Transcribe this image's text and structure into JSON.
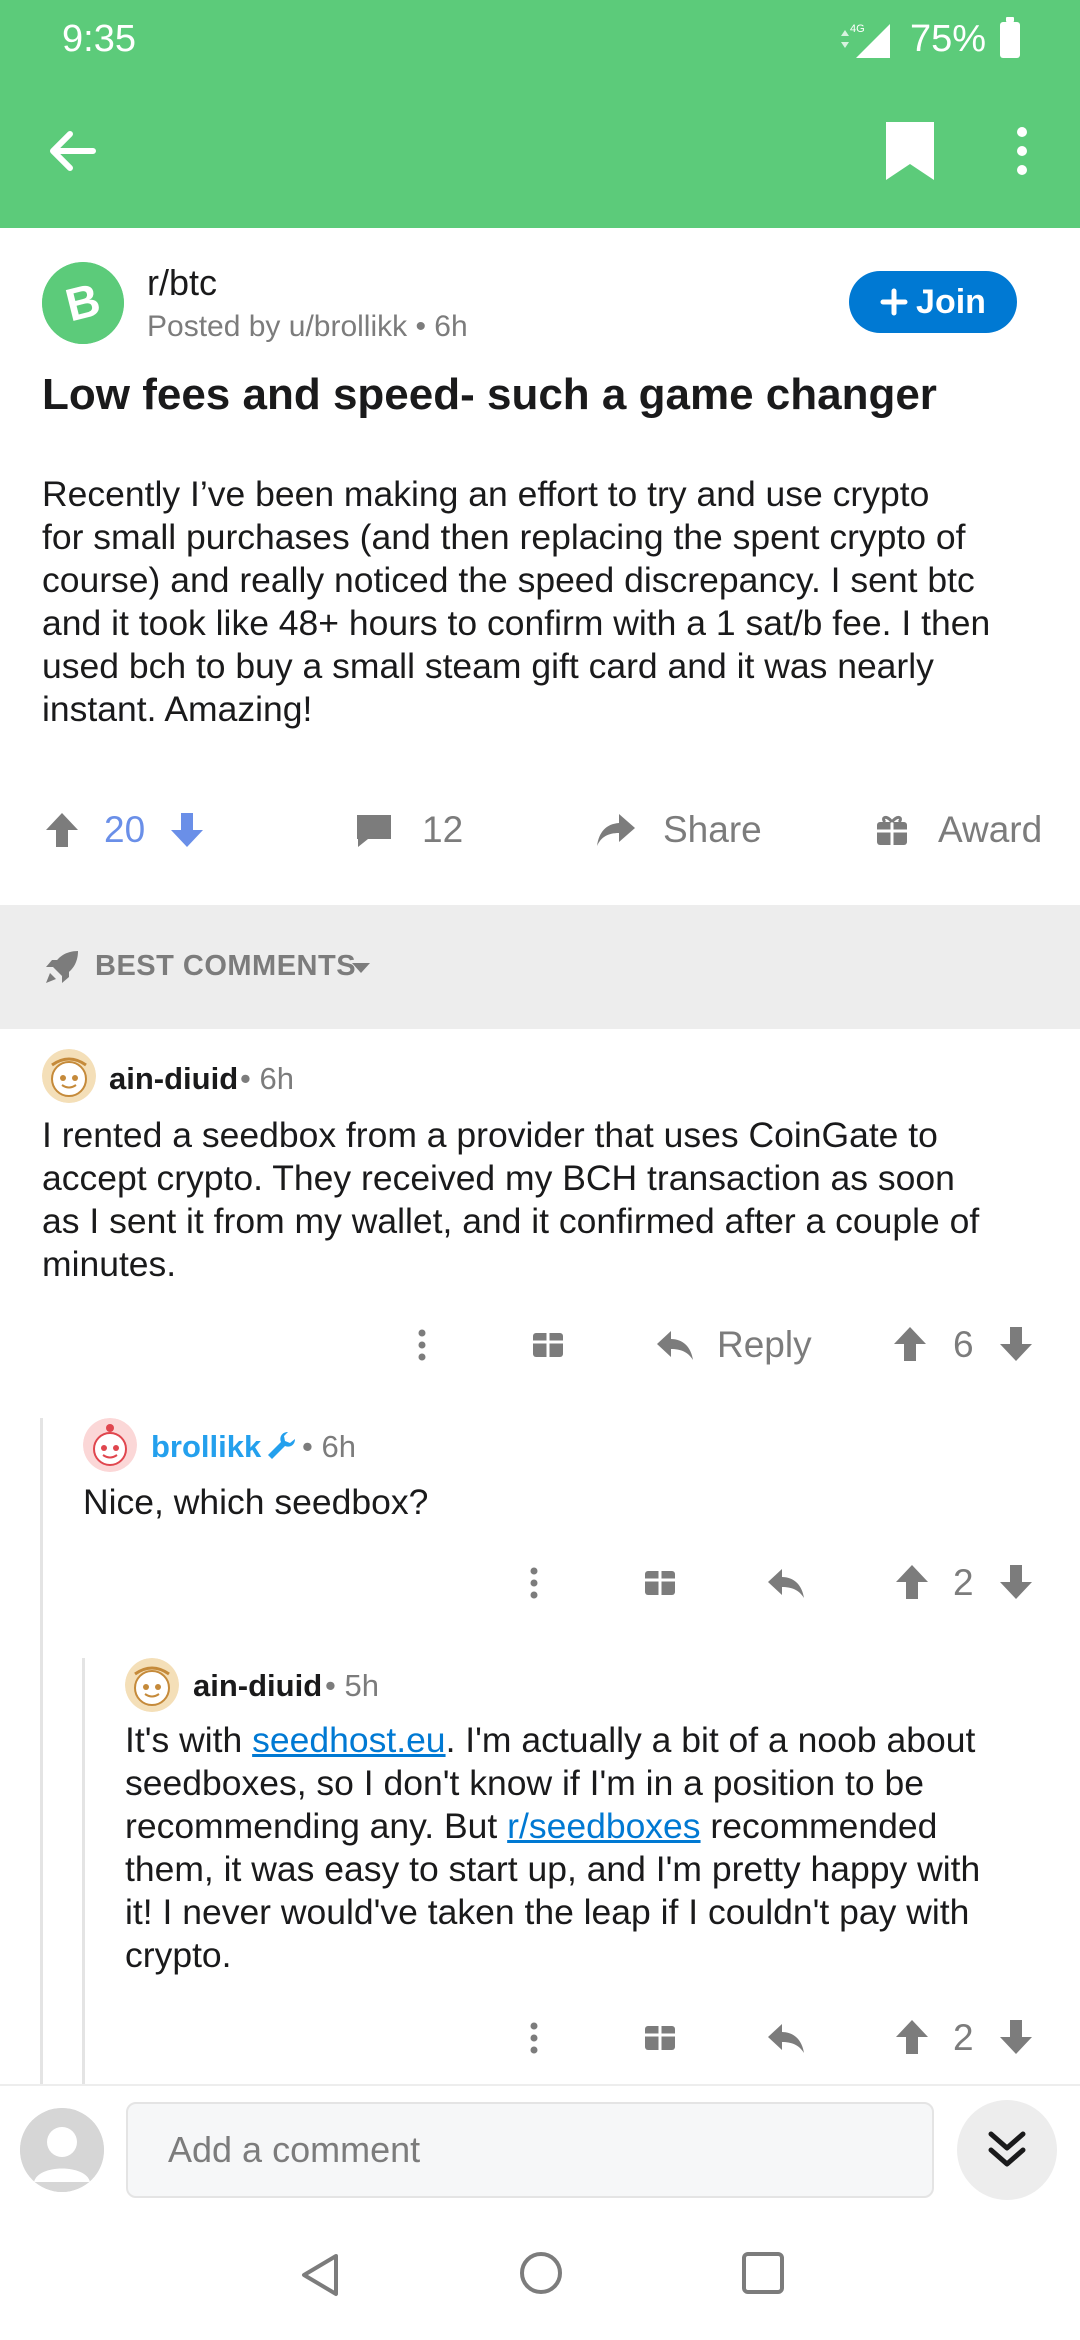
{
  "status_bar": {
    "time": "9:35",
    "network": "4G",
    "battery": "75%"
  },
  "app_bar": {
    "back_icon": "arrow-left-icon",
    "bookmark_icon": "bookmark-icon",
    "more_icon": "more-vert-icon"
  },
  "post": {
    "subreddit": "r/btc",
    "posted_by": "Posted by u/brollikk • 6h",
    "join_label": "Join",
    "title": "Low fees and speed- such a game changer",
    "body_lines": [
      "Recently I’ve been making an effort to try and use crypto",
      "for small purchases (and then replacing the spent crypto of",
      "course) and really noticed the speed discrepancy. I sent btc",
      "and it took like 48+ hours to confirm with a 1 sat/b fee. I then",
      "used bch to buy a small steam gift card and it was nearly",
      "instant. Amazing!"
    ],
    "score": "20",
    "comments": "12",
    "share_label": "Share",
    "award_label": "Award",
    "accent_color": "#5ccb7a",
    "upvote_color": "#6a8fe8"
  },
  "sort": {
    "label": "BEST COMMENTS"
  },
  "comments": [
    {
      "author": "ain-diuid",
      "time": "• 6h",
      "lines": [
        "I rented a seedbox from a provider that uses CoinGate to",
        "accept crypto. They received my BCH transaction as soon",
        "as I sent it from my wallet, and it confirmed after a couple of",
        "minutes."
      ],
      "reply_label": "Reply",
      "score": "6"
    },
    {
      "author": "brollikk",
      "time": "• 6h",
      "text": "Nice, which seedbox?",
      "score": "2",
      "author_color": "#24a0ed"
    },
    {
      "author": "ain-diuid",
      "time": "• 5h",
      "line1_a": "It's with ",
      "link1": "seedhost.eu",
      "line1_b": ". I'm actually a bit of a noob about",
      "line2": "seedboxes, so I don't know if I'm in a position to be",
      "line3_a": "recommending any. But ",
      "link2": "r/seedboxes",
      "line3_b": " recommended",
      "line4": "them, it was easy to start up, and I'm pretty happy with",
      "line5": "it! I never would've taken the leap if I couldn't pay with",
      "line6": "crypto.",
      "score": "2"
    }
  ],
  "comment_bar": {
    "placeholder": "Add a comment"
  }
}
